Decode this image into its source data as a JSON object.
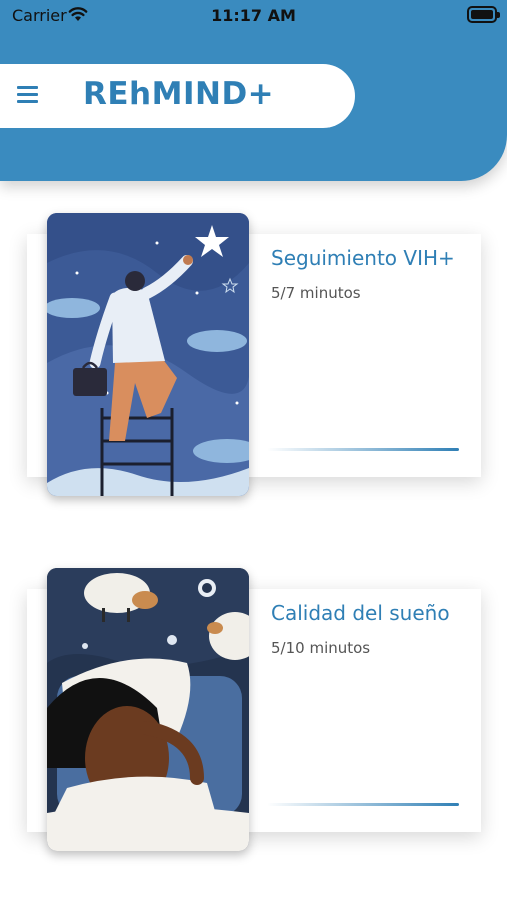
{
  "status_bar": {
    "carrier": "Carrier",
    "time": "11:17 AM"
  },
  "header": {
    "title": "REhMIND+",
    "accent_color": "#3a8bbf",
    "menu_icon": "hamburger-menu-icon"
  },
  "cards": [
    {
      "title": "Seguimiento VIH+",
      "subtitle": "5/7 minutos",
      "illustration": "man-reaching-star-illustration",
      "progress": 0.71
    },
    {
      "title": "Calidad del sueño",
      "subtitle": "5/10 minutos",
      "illustration": "woman-sleeping-sheep-illustration",
      "progress": 0.5
    }
  ]
}
